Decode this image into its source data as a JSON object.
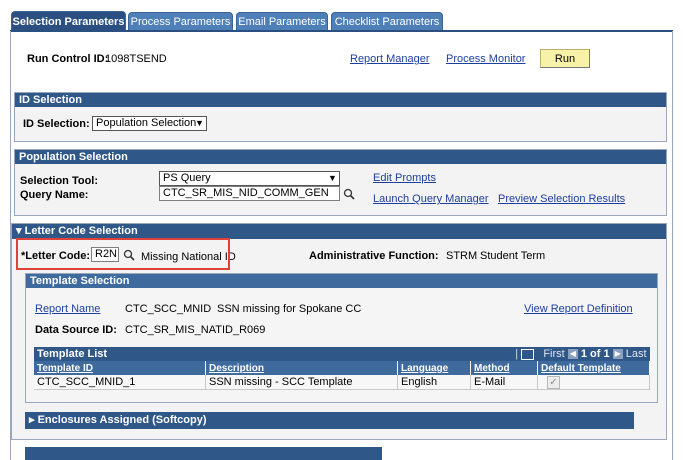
{
  "tabs": [
    {
      "label": "Selection Parameters",
      "active": true
    },
    {
      "label": "Process Parameters",
      "active": false
    },
    {
      "label": "Email Parameters",
      "active": false
    },
    {
      "label": "Checklist Parameters",
      "active": false
    }
  ],
  "run_control": {
    "label": "Run Control ID:",
    "value": "1098TSEND"
  },
  "toolbar": {
    "report_manager": "Report Manager",
    "process_monitor": "Process Monitor",
    "run": "Run"
  },
  "id_selection": {
    "header": "ID Selection",
    "label": "ID Selection:",
    "value": "Population Selection"
  },
  "population_selection": {
    "header": "Population Selection",
    "tool_label": "Selection Tool:",
    "tool_value": "PS Query",
    "query_label": "Query Name:",
    "query_value": "CTC_SR_MIS_NID_COMM_GEN",
    "edit_prompts": "Edit Prompts",
    "launch_query_manager": "Launch Query Manager",
    "preview_results": "Preview Selection Results"
  },
  "letter_code_selection": {
    "header": "Letter Code Selection",
    "letter_code_label": "*Letter Code:",
    "letter_code_value": "R2N",
    "letter_code_desc": "Missing National ID",
    "admin_function_label": "Administrative Function:",
    "admin_function_code": "STRM",
    "admin_function_desc": "Student Term"
  },
  "template_selection": {
    "header": "Template Selection",
    "report_name_label": "Report Name",
    "report_name_value": "CTC_SCC_MNID",
    "report_name_desc": "SSN missing for Spokane CC",
    "view_report_definition": "View Report Definition",
    "data_source_label": "Data Source ID:",
    "data_source_value": "CTC_SR_MIS_NATID_R069"
  },
  "template_list": {
    "title": "Template List",
    "nav": {
      "first": "First",
      "range": "1 of 1",
      "last": "Last"
    },
    "columns": [
      "Template ID",
      "Description",
      "Language",
      "Method",
      "Default Template"
    ],
    "rows": [
      {
        "template_id": "CTC_SCC_MNID_1",
        "description": "SSN missing - SCC Template",
        "language": "English",
        "method": "E-Mail",
        "default_template": true
      }
    ]
  },
  "enclosures": {
    "header": "Enclosures Assigned (Softcopy)"
  }
}
